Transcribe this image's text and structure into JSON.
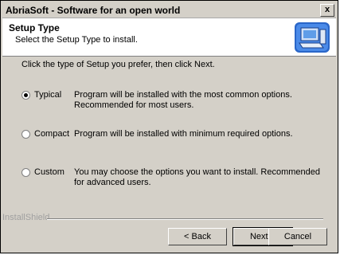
{
  "window": {
    "title": "AbriaSoft  - Software for an open world",
    "close_label": "x"
  },
  "header": {
    "title": "Setup Type",
    "subtitle": "Select the Setup Type to install."
  },
  "body": {
    "instruction": "Click the type of Setup you prefer, then click Next.",
    "options": [
      {
        "label": "Typical",
        "description": "Program will be installed with the most common options.  Recommended for most users.",
        "selected": true
      },
      {
        "label": "Compact",
        "description": "Program will be installed with minimum required options.",
        "selected": false
      },
      {
        "label": "Custom",
        "description": "You may choose the options you want to install. Recommended for advanced users.",
        "selected": false
      }
    ]
  },
  "footer": {
    "brand": "InstallShield",
    "back_label": "< Back",
    "next_label": "Next >",
    "cancel_label": "Cancel"
  },
  "icons": {
    "header_icon": "computer-setup-icon"
  }
}
